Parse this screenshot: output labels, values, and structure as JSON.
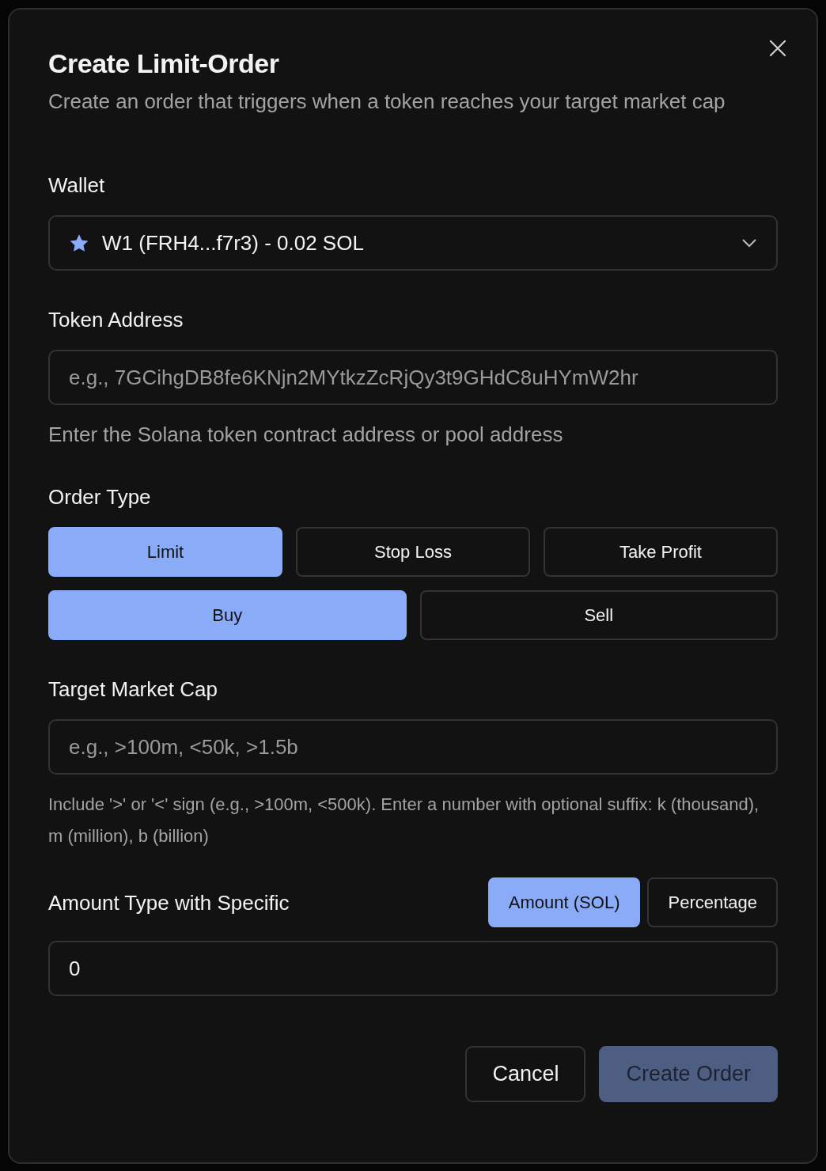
{
  "dialog": {
    "title": "Create Limit-Order",
    "description": "Create an order that triggers when a token reaches your target market cap"
  },
  "wallet": {
    "label": "Wallet",
    "value": "W1 (FRH4...f7r3) - 0.02 SOL"
  },
  "token_address": {
    "label": "Token Address",
    "placeholder": "e.g., 7GCihgDB8fe6KNjn2MYtkzZcRjQy3t9GHdC8uHYmW2hr",
    "help": "Enter the Solana token contract address or pool address"
  },
  "order_type": {
    "label": "Order Type",
    "types": [
      {
        "label": "Limit",
        "selected": true
      },
      {
        "label": "Stop Loss",
        "selected": false
      },
      {
        "label": "Take Profit",
        "selected": false
      }
    ],
    "sides": [
      {
        "label": "Buy",
        "selected": true
      },
      {
        "label": "Sell",
        "selected": false
      }
    ]
  },
  "target_market_cap": {
    "label": "Target Market Cap",
    "placeholder": "e.g., >100m, <50k, >1.5b",
    "help": "Include '>' or '<' sign (e.g., >100m, <500k). Enter a number with optional suffix: k (thousand), m (million), b (billion)"
  },
  "amount": {
    "label": "Amount Type with Specific",
    "modes": [
      {
        "label": "Amount (SOL)",
        "selected": true
      },
      {
        "label": "Percentage",
        "selected": false
      }
    ],
    "value": "0"
  },
  "buttons": [
    {
      "label": "Cancel",
      "kind": "secondary",
      "disabled": false
    },
    {
      "label": "Create Order",
      "kind": "primary",
      "disabled": true
    }
  ]
}
